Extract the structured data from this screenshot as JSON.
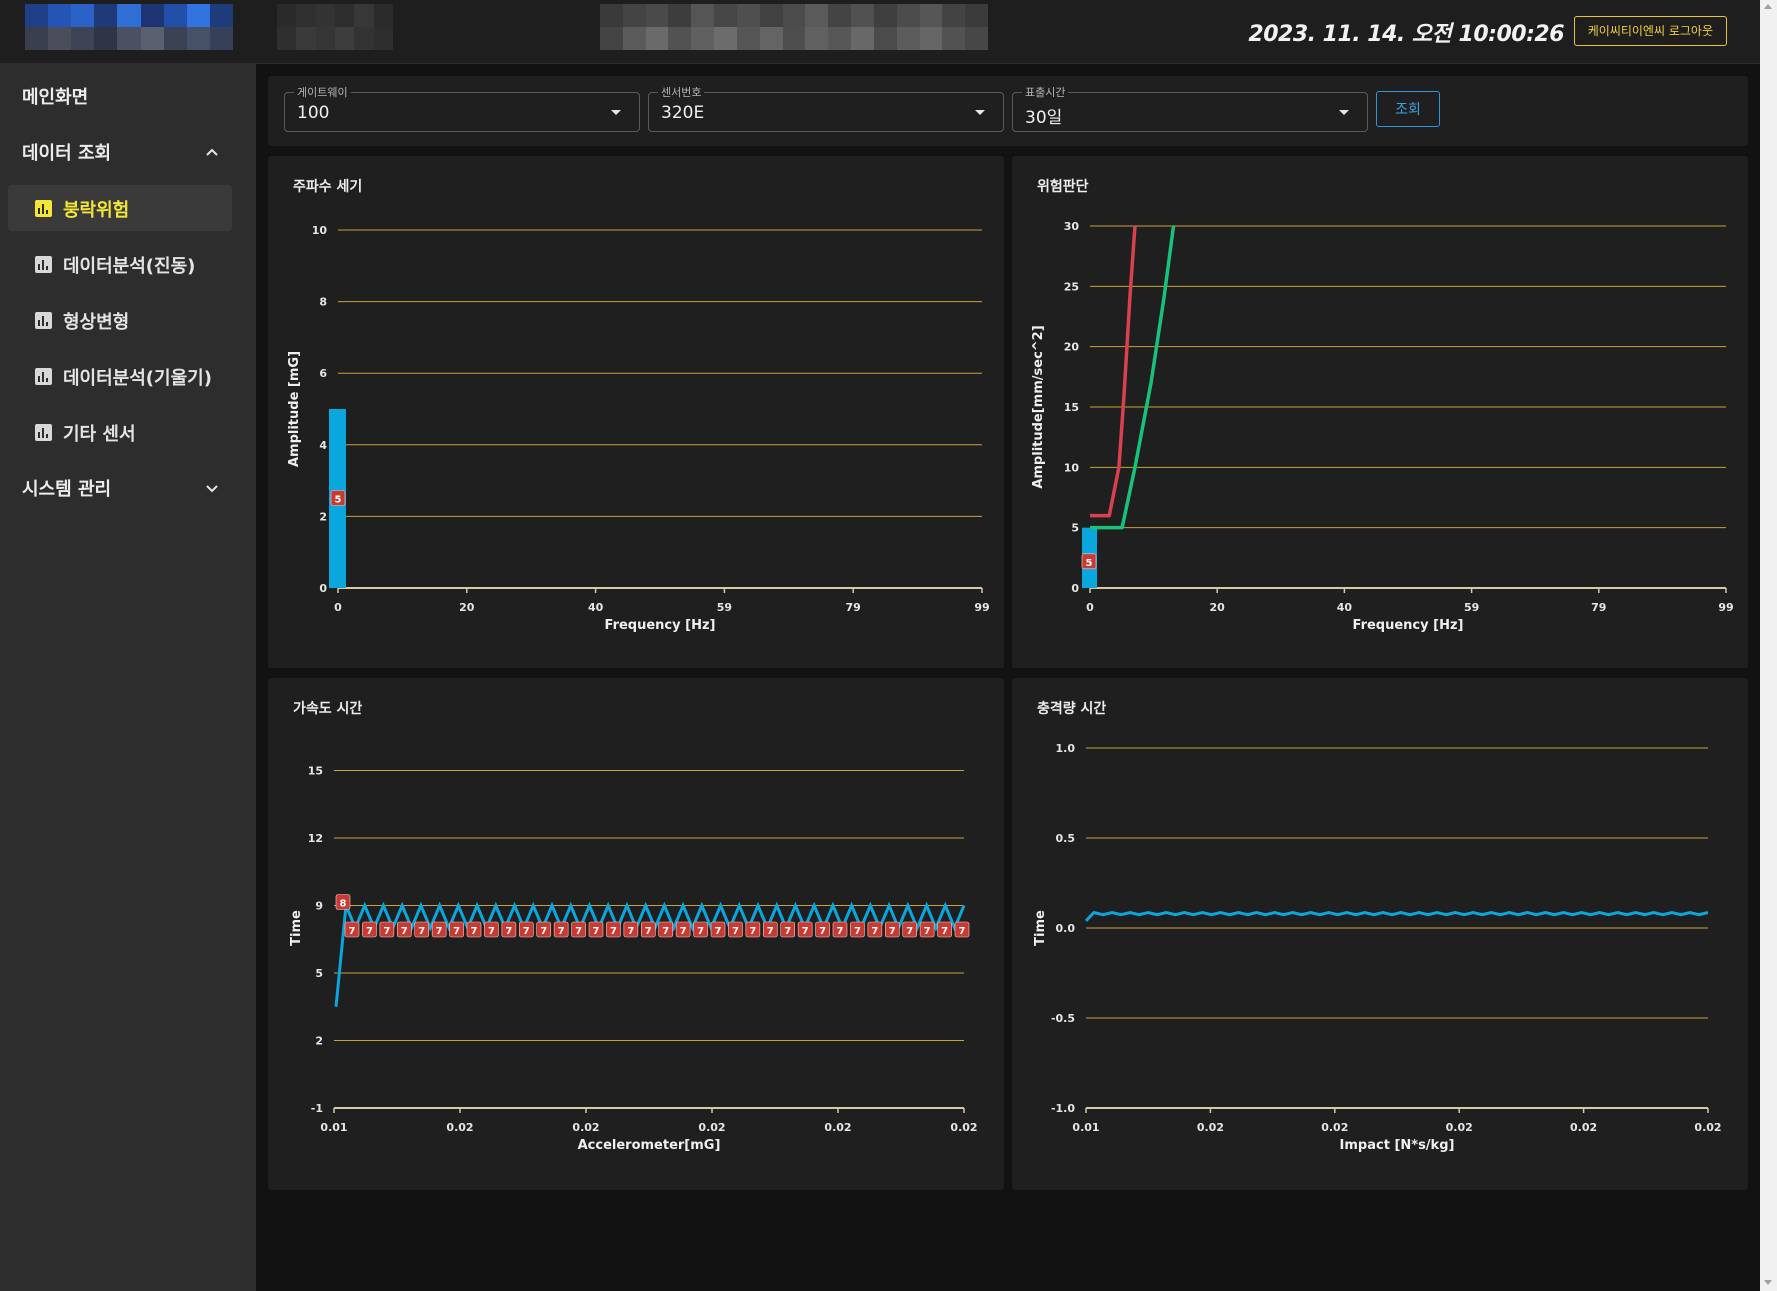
{
  "header": {
    "datetime": "2023. 11. 14. 오전 10:00:26",
    "logout_label": "케이씨티이엔씨 로그아웃"
  },
  "sidebar": {
    "main_label": "메인화면",
    "data_group_label": "데이터 조회",
    "items": [
      {
        "label": "붕락위험",
        "active": true
      },
      {
        "label": "데이터분석(진동)",
        "active": false
      },
      {
        "label": "형상변형",
        "active": false
      },
      {
        "label": "데이터분석(기울기)",
        "active": false
      },
      {
        "label": "기타 센서",
        "active": false
      }
    ],
    "system_group_label": "시스템 관리"
  },
  "filters": {
    "gateway": {
      "label": "게이트웨이",
      "value": "100"
    },
    "sensor": {
      "label": "센서번호",
      "value": "320E"
    },
    "period": {
      "label": "표출시간",
      "value": "30일"
    },
    "query_label": "조회"
  },
  "colors": {
    "accent": "#f3e637",
    "grid": "#c7a13a",
    "series_blue": "#0aa7de",
    "series_red": "#d9414f",
    "series_green": "#19c27a",
    "label_red": "#c83a32"
  },
  "chart_data": [
    {
      "id": "freq",
      "type": "bar",
      "title": "주파수 세기",
      "xlabel": "Frequency [Hz]",
      "ylabel": "Amplitude [mG]",
      "x_ticks": [
        "0",
        "20",
        "40",
        "59",
        "79",
        "99"
      ],
      "x_range": [
        0,
        99
      ],
      "y_ticks": [
        "0",
        "2",
        "4",
        "6",
        "8",
        "10"
      ],
      "ylim": [
        0,
        10
      ],
      "grid": true,
      "bars": [
        {
          "x": 0,
          "value": 5,
          "label": "5"
        }
      ]
    },
    {
      "id": "risk",
      "type": "line",
      "title": "위험판단",
      "xlabel": "Frequency [Hz]",
      "ylabel": "Amplitude[mm/sec^2]",
      "x_ticks": [
        "0",
        "20",
        "40",
        "59",
        "79",
        "99"
      ],
      "x_range": [
        0,
        99
      ],
      "y_ticks": [
        "0",
        "5",
        "10",
        "15",
        "20",
        "25",
        "30"
      ],
      "ylim": [
        0,
        30
      ],
      "grid": true,
      "bars": [
        {
          "x": 0,
          "value": 5,
          "label": "5"
        }
      ],
      "series": [
        {
          "color": "red",
          "x": [
            0,
            3,
            4.5,
            5.3,
            6.2,
            7
          ],
          "y": [
            6,
            6,
            10,
            16,
            24,
            30
          ]
        },
        {
          "color": "green",
          "x": [
            0,
            5,
            7,
            9.5,
            11.5,
            13
          ],
          "y": [
            5,
            5,
            10,
            17,
            24,
            30
          ]
        }
      ]
    },
    {
      "id": "accel",
      "type": "line",
      "title": "가속도 시간",
      "xlabel": "Accelerometer[mG]",
      "ylabel": "Time",
      "x_ticks": [
        "0.01",
        "0.02",
        "0.02",
        "0.02",
        "0.02",
        "0.02"
      ],
      "y_ticks": [
        "-1",
        "2",
        "5",
        "9",
        "12",
        "15"
      ],
      "ylim": [
        -1,
        15
      ],
      "grid": true,
      "series": [
        {
          "name": "",
          "start": 3.5,
          "peak": 8,
          "trough": 7,
          "peaks": 33,
          "point_labels": {
            "first": "8",
            "others": "7"
          }
        }
      ]
    },
    {
      "id": "impact",
      "type": "line",
      "title": "충격량 시간",
      "xlabel": "Impact [N*s/kg]",
      "ylabel": "Time",
      "x_ticks": [
        "0.01",
        "0.02",
        "0.02",
        "0.02",
        "0.02",
        "0.02"
      ],
      "y_ticks": [
        "-1.0",
        "-0.5",
        "0.0",
        "0.5",
        "1.0"
      ],
      "ylim": [
        -1,
        1
      ],
      "grid": true,
      "series": [
        {
          "name": "",
          "start": 0.04,
          "level": 0.08,
          "wave_amplitude": 0.012,
          "cycles": 34
        }
      ]
    }
  ]
}
